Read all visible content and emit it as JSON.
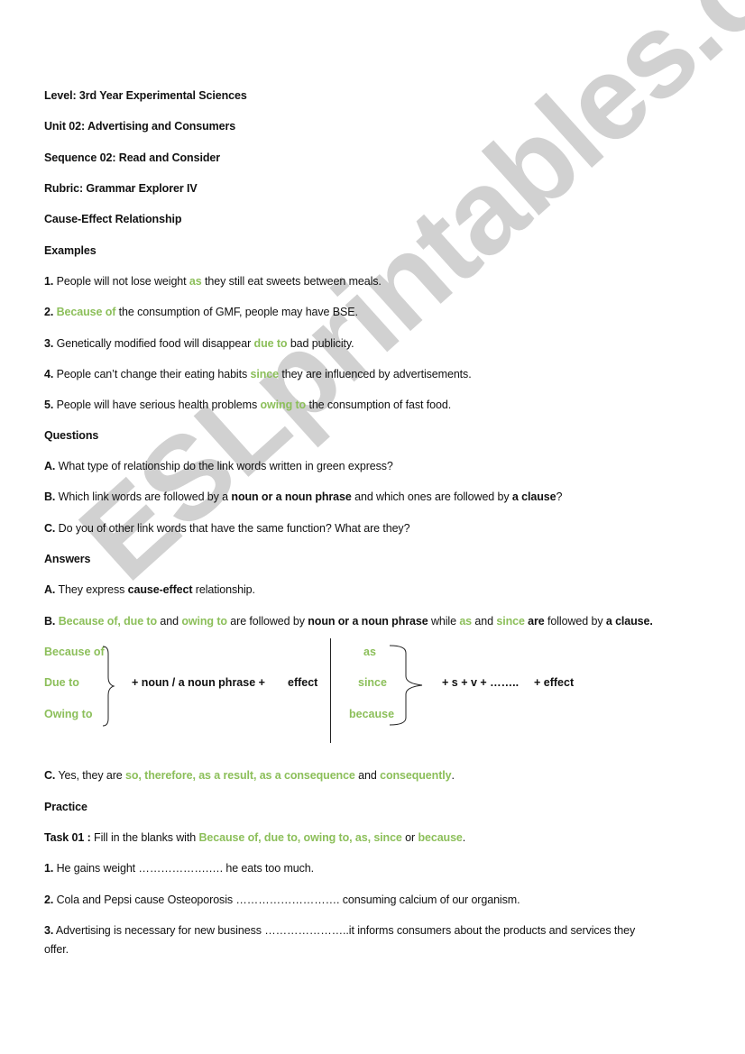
{
  "watermark": "ESLprintables.com",
  "header": {
    "level": "Level: 3rd Year Experimental Sciences",
    "unit": "Unit 02: Advertising and Consumers",
    "sequence": "Sequence 02: Read and Consider",
    "rubric": "Rubric: Grammar Explorer IV",
    "topic": "Cause-Effect Relationship"
  },
  "colors": {
    "link_word_green": "#8cbf5a",
    "text": "#111111",
    "watermark": "#c9c9c9"
  },
  "examples": {
    "heading": "Examples",
    "items": [
      {
        "num": "1.",
        "before": " People will not lose weight ",
        "link": "as",
        "after": " they still eat sweets between meals."
      },
      {
        "num": "2.",
        "before": " ",
        "link": "Because of",
        "after": " the consumption of GMF, people may have BSE."
      },
      {
        "num": "3.",
        "before": " Genetically modified food will disappear ",
        "link": "due to",
        "after": " bad publicity."
      },
      {
        "num": "4.",
        "before": " People can’t change their eating habits ",
        "link": "since",
        "after": " they are influenced by advertisements."
      },
      {
        "num": "5.",
        "before": " People will have serious health problems ",
        "link": "owing to",
        "after": " the consumption of fast food."
      }
    ]
  },
  "questions": {
    "heading": "Questions",
    "a": {
      "label": "A.",
      "text": " What type of relationship do the link words written in green express?"
    },
    "b": {
      "label": "B.",
      "t1": " Which link words are followed by a ",
      "bold1": "noun or a noun phrase",
      "t2": " and which ones are followed by ",
      "bold2": "a clause",
      "t3": "?"
    },
    "c": {
      "label": "C.",
      "text": " Do you of other link words that have the same function? What are they?"
    }
  },
  "answers": {
    "heading": "Answers",
    "a": {
      "label": "A.",
      "t1": "  They express ",
      "bold": "cause-effect",
      "t2": " relationship."
    },
    "b": {
      "label": "B.",
      "g1": "Because of, due to",
      "t1": " and ",
      "g2": "owing to",
      "t2": " are followed by ",
      "bold1": "noun or a noun phrase",
      "t3": " while ",
      "g3": "as",
      "t4": " and ",
      "g4": "since",
      "bold2": " are",
      "t5": " followed by ",
      "bold3": "a clause."
    },
    "diagram": {
      "left_words": [
        "Because of",
        "Due to",
        "Owing to"
      ],
      "left_formula": "+ noun / a noun phrase +",
      "left_result": "effect",
      "right_words": [
        "as",
        "since",
        "because"
      ],
      "right_formula": "+  s + v + ……..",
      "right_result": "+ effect"
    },
    "c": {
      "label": "C.",
      "t1": " Yes, they are ",
      "g1": "so, therefore, as a result, as a consequence",
      "t2": " and ",
      "g2": "consequently",
      "t3": "."
    }
  },
  "practice": {
    "heading": "Practice",
    "task": {
      "label": "Task 01 :",
      "t1": " Fill in the blanks with ",
      "g1": "Because of, due to, owing to, as, since",
      "t2": " or ",
      "g2": "because",
      "t3": "."
    },
    "items": [
      {
        "num": "1.",
        "text": " He gains weight ……………….…. he eats too much."
      },
      {
        "num": "2.",
        "text": " Cola and Pepsi cause Osteoporosis ……………………….  consuming calcium of our organism."
      },
      {
        "num": "3.",
        "text": "   Advertising is necessary for new business …………………..it informs consumers about the products and services they",
        "cont": "offer."
      }
    ]
  }
}
